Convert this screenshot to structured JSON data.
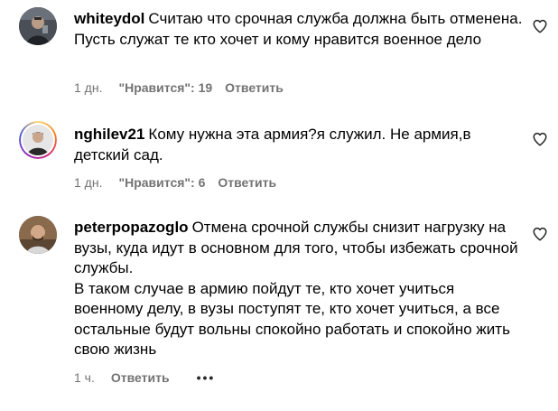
{
  "comments": [
    {
      "username": "whiteydol",
      "text": "Считаю что срочная служба должна быть отменена. Пусть служат те кто хочет и кому нравится военное дело",
      "time": "1 дн.",
      "likes": "\"Нравится\": 19",
      "reply_label": "Ответить",
      "avatar_icon": "user-photo-icon",
      "like_icon": "heart-outline-icon"
    },
    {
      "username": "nghilev21",
      "text": "Кому нужна эта армия?я служил. Не армия,в детский сад.",
      "time": "1 дн.",
      "likes": "\"Нравится\": 6",
      "reply_label": "Ответить",
      "avatar_icon": "user-photo-story-ring-icon",
      "like_icon": "heart-outline-icon"
    },
    {
      "username": "peterpopazoglo",
      "text_line1": "Отмена срочной службы снизит нагрузку на вузы, куда идут в основном для того, чтобы избежать срочной службы.",
      "text_line2": "В таком случае в армию пойдут те, кто хочет учиться военному делу, в вузы поступят те, кто хочет учиться, а все остальные будут вольны спокойно работать и спокойно жить свою жизнь",
      "time": "1 ч.",
      "reply_label": "Ответить",
      "more_label": "•••",
      "avatar_icon": "user-photo-icon",
      "like_icon": "heart-outline-icon"
    }
  ],
  "colors": {
    "text": "#000000",
    "meta": "#737373",
    "background": "#ffffff"
  }
}
